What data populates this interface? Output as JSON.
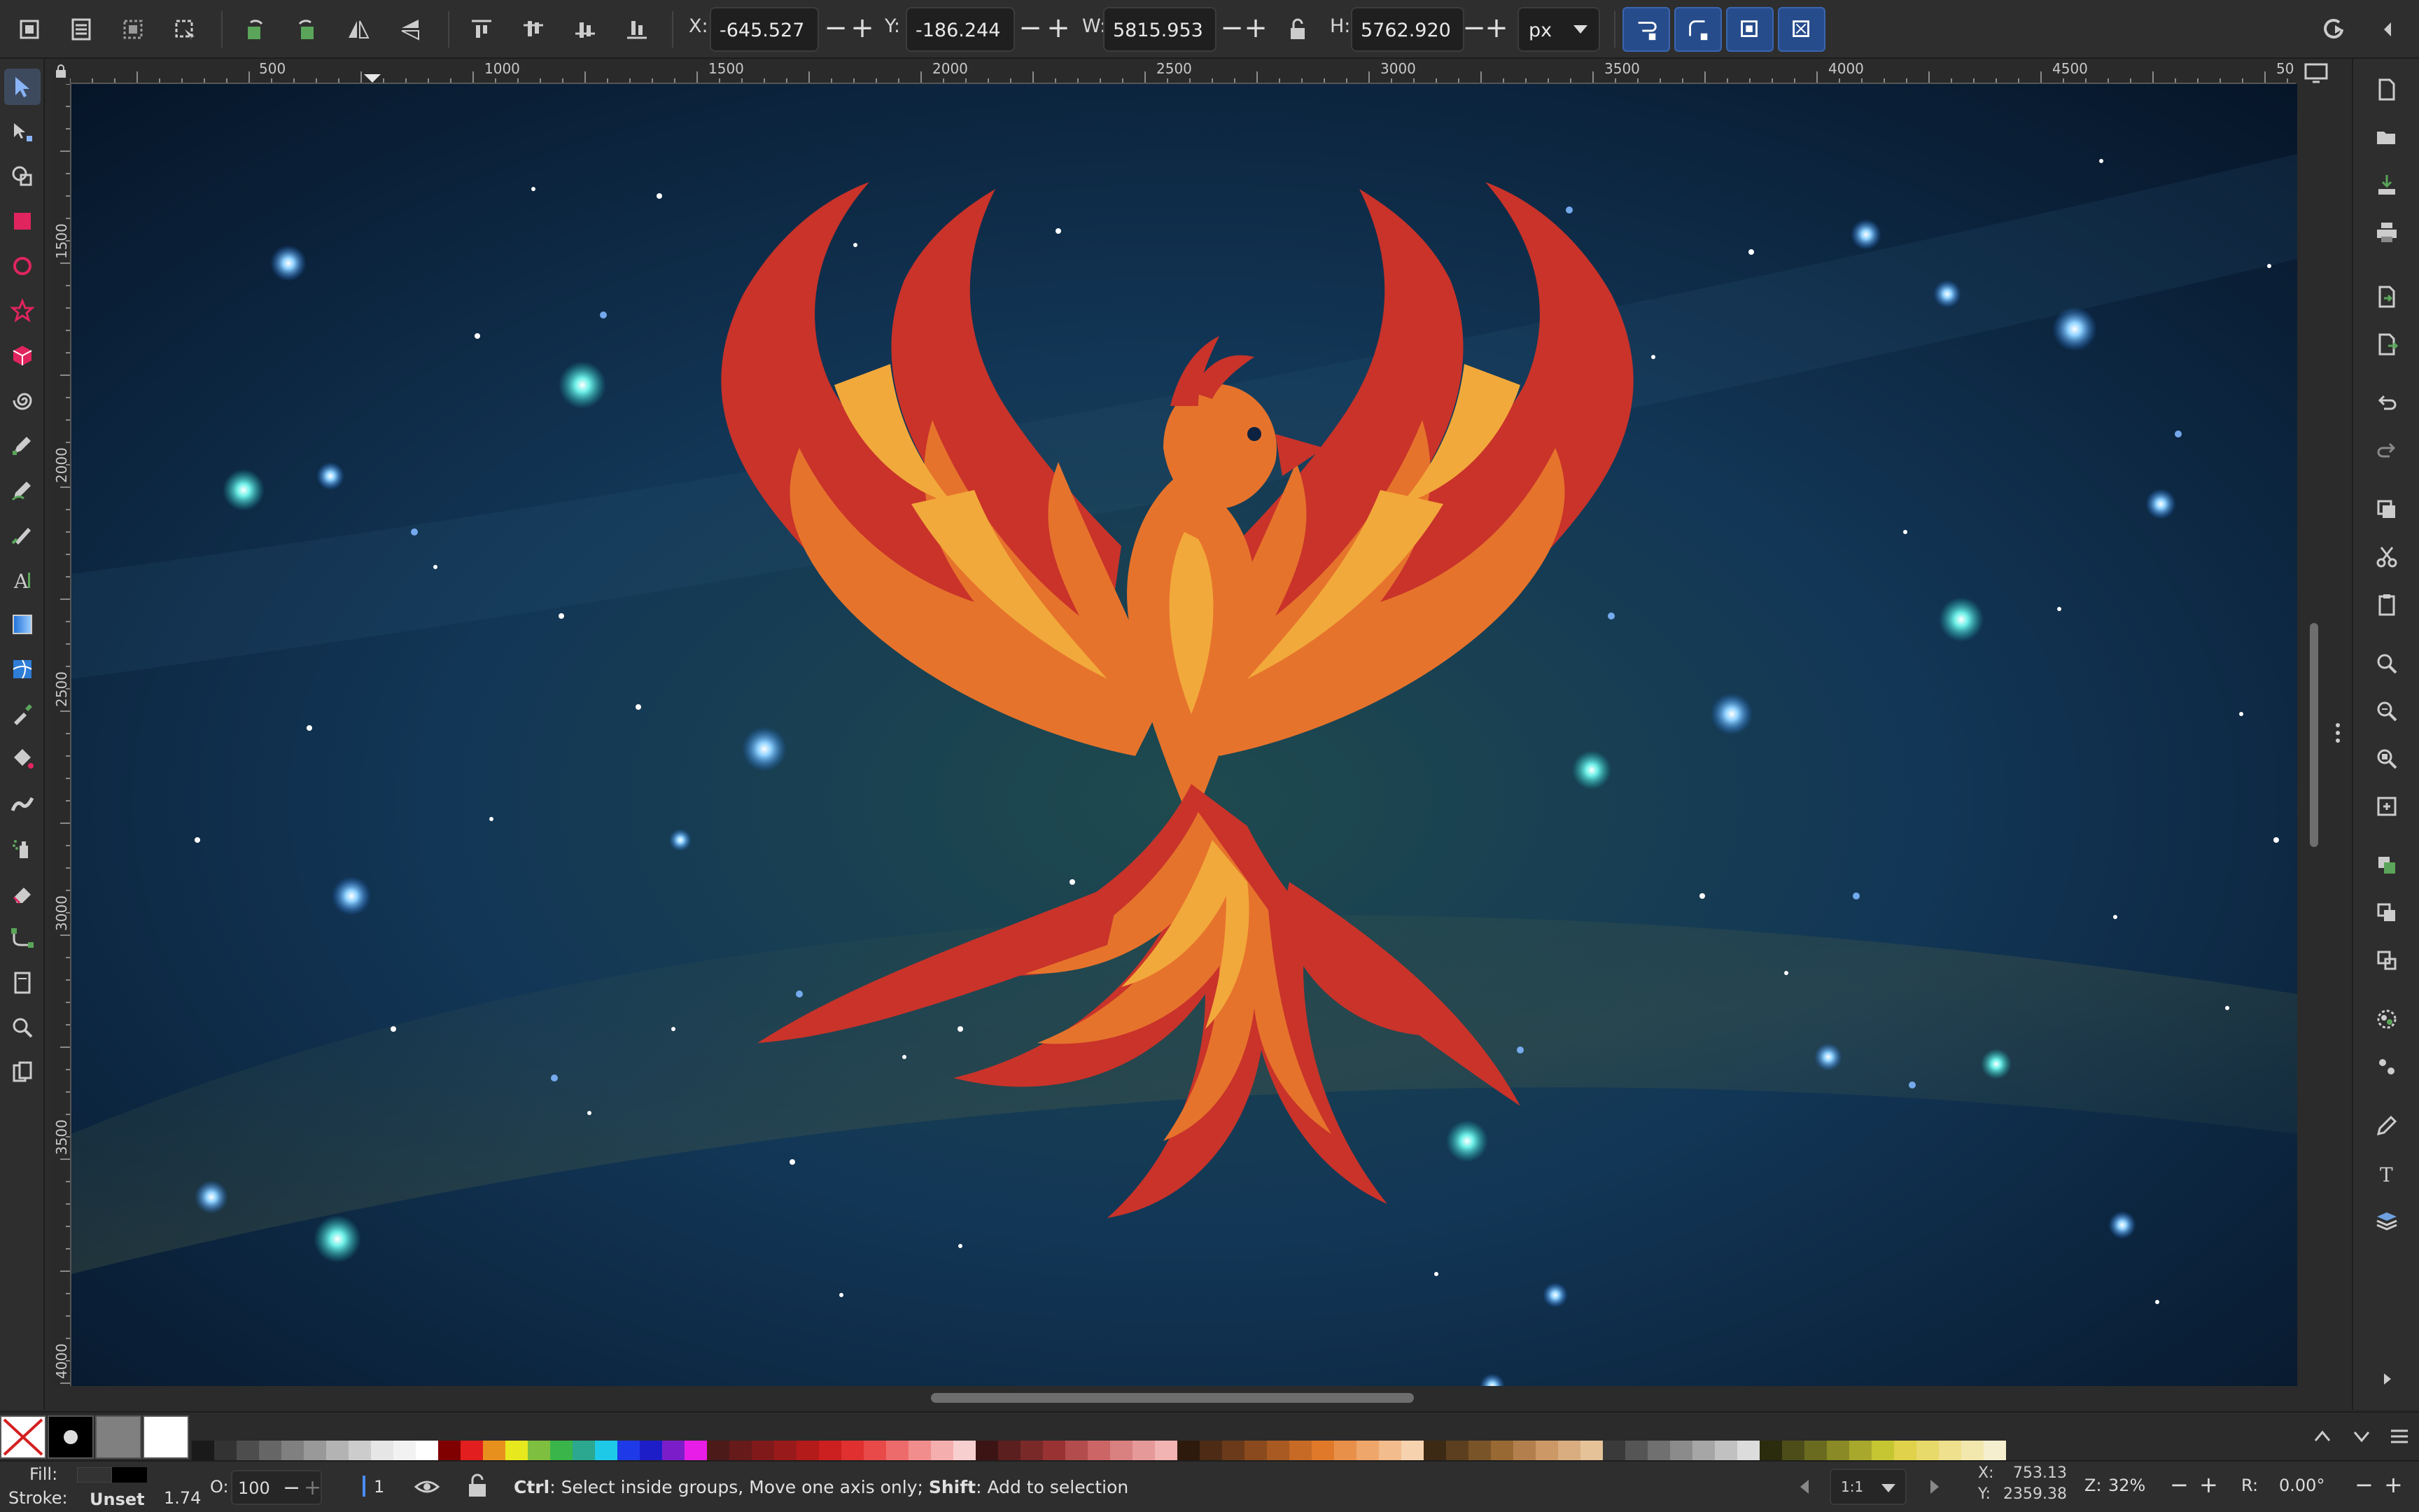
{
  "toolbar": {
    "x_label": "X:",
    "x_value": "-645.527",
    "y_label": "Y:",
    "y_value": "-186.244",
    "w_label": "W:",
    "w_value": "5815.953",
    "h_label": "H:",
    "h_value": "5762.920",
    "unit": "px",
    "minus": "−",
    "plus": "+"
  },
  "rulers": {
    "horizontal": [
      "500",
      "1000",
      "1500",
      "2000",
      "2500",
      "3000",
      "3500",
      "4000",
      "4500",
      "50"
    ],
    "vertical": [
      "1500",
      "2000",
      "2500",
      "3000",
      "3500",
      "4000"
    ]
  },
  "status": {
    "fill_label": "Fill:",
    "stroke_label": "Stroke:",
    "stroke_value": "Unset",
    "stroke_width": "1.74",
    "opacity_label": "O:",
    "opacity_value": "100",
    "layer_value": "1",
    "message_ctrl": "Ctrl",
    "message_ctrl_text": ": Select inside groups, Move one axis only; ",
    "message_shift": "Shift",
    "message_shift_text": ": Add to selection",
    "snap_value": "1:1",
    "cursor_x_label": "X:",
    "cursor_x": "753.13",
    "cursor_y_label": "Y:",
    "cursor_y": "2359.38",
    "zoom_label": "Z:",
    "zoom_value": "32%",
    "rotation_label": "R:",
    "rotation_value": "0.00°"
  },
  "icons": {
    "tools": [
      "selector-tool-icon",
      "node-tool-icon",
      "shape-builder-icon",
      "rectangle-tool-icon",
      "ellipse-tool-icon",
      "star-tool-icon",
      "box3d-tool-icon",
      "spiral-tool-icon",
      "pen-tool-icon",
      "pencil-tool-icon",
      "calligraphy-tool-icon",
      "text-tool-icon",
      "gradient-tool-icon",
      "mesh-tool-icon",
      "dropper-tool-icon",
      "paint-bucket-icon",
      "tweak-tool-icon",
      "spray-tool-icon",
      "eraser-tool-icon",
      "connector-tool-icon",
      "pages-tool-icon",
      "zoom-tool-icon",
      "pages-icon"
    ],
    "commands": [
      "new-document-icon",
      "open-icon",
      "import-icon",
      "print-icon",
      "export-icon",
      "export-png-icon",
      "undo-icon",
      "redo-icon",
      "copy-icon",
      "cut-icon",
      "paste-icon",
      "zoom-selection-icon",
      "zoom-drawing-icon",
      "zoom-page-icon",
      "zoom-fit-icon",
      "duplicate-icon",
      "clone-icon",
      "unlink-clone-icon",
      "group-icon",
      "ungroup-icon",
      "fill-stroke-icon",
      "text-font-icon",
      "layers-icon",
      "expand-icon"
    ]
  },
  "palette_colors": [
    "#1a1a1a",
    "#333333",
    "#4d4d4d",
    "#666666",
    "#808080",
    "#999999",
    "#b3b3b3",
    "#cccccc",
    "#e6e6e6",
    "#f2f2f2",
    "#ffffff",
    "#800000",
    "#e21e1e",
    "#e8901e",
    "#e8e81e",
    "#7fbf3f",
    "#39b54a",
    "#2ba88f",
    "#1ec9e8",
    "#1e39e8",
    "#1e1ec9",
    "#7b1ec9",
    "#e81ee8",
    "#4d1a1a",
    "#661a1a",
    "#801a1a",
    "#991a1a",
    "#b31a1a",
    "#cc1f1f",
    "#e03030",
    "#e84a4a",
    "#ee6b6b",
    "#f28d8d",
    "#f5aeae",
    "#f8cfcf",
    "#3d1414",
    "#5c1f1f",
    "#7a2929",
    "#993333",
    "#b34d4d",
    "#cc6666",
    "#d98080",
    "#e69999",
    "#f2b3b3",
    "#2d1a0d",
    "#4d2b14",
    "#6b3a1a",
    "#8a4a1e",
    "#a85a22",
    "#c66a26",
    "#e07a2a",
    "#e8904a",
    "#eea66b",
    "#f2bc8d",
    "#f6d2ae",
    "#3d2a14",
    "#5c3f1f",
    "#7a5429",
    "#996933",
    "#b3804d",
    "#cc9966",
    "#d9ad80",
    "#e6c299",
    "#3a3a3a",
    "#555555",
    "#707070",
    "#8b8b8b",
    "#a6a6a6",
    "#c1c1c1",
    "#dcdcdc",
    "#2b2b0d",
    "#4d4d1a",
    "#6b6b1f",
    "#8a8a26",
    "#a8a82d",
    "#c6c633",
    "#e0d24a",
    "#e8d96b",
    "#eee08d",
    "#f2e8ae",
    "#f6efcf"
  ]
}
